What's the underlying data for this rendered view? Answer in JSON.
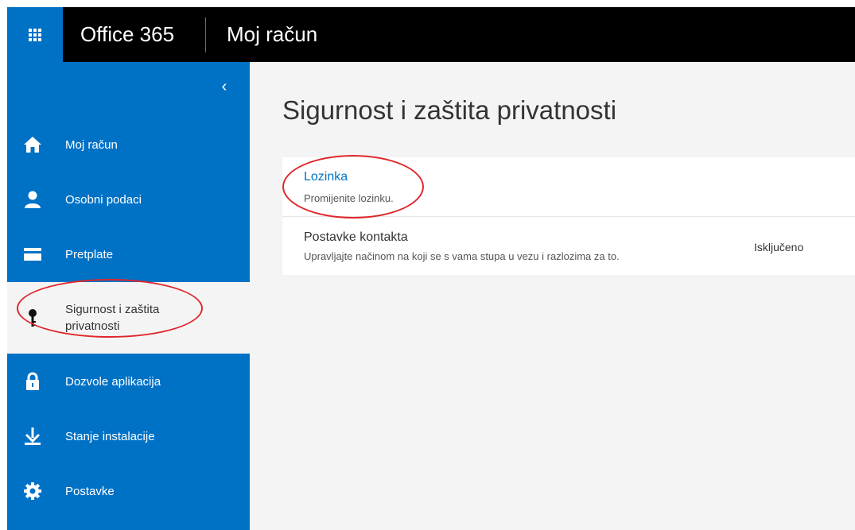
{
  "header": {
    "brand": "Office 365",
    "app_title": "Moj račun"
  },
  "sidebar": {
    "collapse_glyph": "‹",
    "items": [
      {
        "label": "Moj račun",
        "icon": "home-icon"
      },
      {
        "label": "Osobni podaci",
        "icon": "person-icon"
      },
      {
        "label": "Pretplate",
        "icon": "credit-card-icon"
      },
      {
        "label": "Sigurnost i zaštita privatnosti",
        "icon": "key-icon",
        "active": true
      },
      {
        "label": "Dozvole aplikacija",
        "icon": "lock-icon"
      },
      {
        "label": "Stanje instalacije",
        "icon": "download-icon"
      },
      {
        "label": "Postavke",
        "icon": "gear-icon"
      }
    ]
  },
  "main": {
    "title": "Sigurnost i zaštita privatnosti",
    "settings": [
      {
        "title": "Lozinka",
        "description": "Promijenite lozinku.",
        "value": ""
      },
      {
        "title": "Postavke kontakta",
        "description": "Upravljajte načinom na koji se s vama stupa u vezu i razlozima za to.",
        "value": "Isključeno"
      }
    ]
  },
  "colors": {
    "accent": "#0072c6",
    "topbar": "#000000",
    "annotation": "#e0262b"
  }
}
